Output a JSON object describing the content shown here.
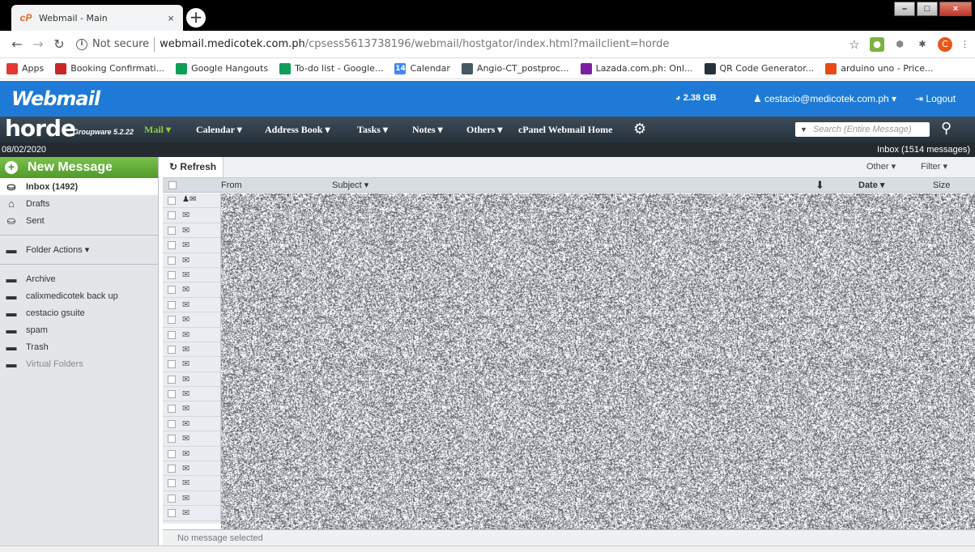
{
  "browser": {
    "tab_title": "Webmail - Main",
    "tab_close": "×",
    "new_tab": "+",
    "security_label": "Not secure",
    "url_host": "webmail.medicotek.com.ph",
    "url_path": "/cpsess5613738196/webmail/hostgator/index.html?mailclient=horde",
    "window_controls": [
      "–",
      "□",
      "×"
    ]
  },
  "bookmarks": [
    {
      "label": "Apps",
      "color": "#e53935",
      "icon": "apps-grid-icon"
    },
    {
      "label": "Booking Confirmati...",
      "color": "#c62828",
      "icon": "airasia-icon"
    },
    {
      "label": "Google Hangouts",
      "color": "#0f9d58",
      "icon": "hangouts-icon"
    },
    {
      "label": "To-do list - Google...",
      "color": "#0f9d58",
      "icon": "todo-icon"
    },
    {
      "label": "Calendar",
      "color": "#4285f4",
      "icon": "calendar-icon",
      "glyph": "14"
    },
    {
      "label": "Angio-CT_postproc...",
      "color": "#455a64",
      "icon": "image-icon"
    },
    {
      "label": "Lazada.com.ph: Onl...",
      "color": "#7b1fa2",
      "icon": "lazada-icon"
    },
    {
      "label": "QR Code Generator...",
      "color": "#263238",
      "icon": "qr-icon"
    },
    {
      "label": "arduino uno - Price...",
      "color": "#e64a19",
      "icon": "shop-icon"
    }
  ],
  "webmail": {
    "logo": "Webmail",
    "quota": "2.38 GB",
    "user": "cestacio@medicotek.com.ph",
    "logout": "Logout"
  },
  "horde": {
    "logo": "horde",
    "version": "Groupware 5.2.22",
    "nav": [
      {
        "label": "Mail ▾",
        "active": true
      },
      {
        "label": "Calendar ▾",
        "active": false
      },
      {
        "label": "Address Book ▾",
        "active": false
      },
      {
        "label": "Tasks ▾",
        "active": false
      },
      {
        "label": "Notes ▾",
        "active": false
      },
      {
        "label": "Others ▾",
        "active": false
      },
      {
        "label": "cPanel Webmail Home",
        "active": false
      }
    ],
    "search_placeholder": "Search (Entire Message)"
  },
  "datebar": {
    "date": "08/02/2020",
    "inbox_summary": "Inbox (1514 messages)"
  },
  "sidebar": {
    "new_message": "New Message",
    "folders_top": [
      {
        "label": "Inbox (1492)",
        "icon": "inbox-icon",
        "active": true
      },
      {
        "label": "Drafts",
        "icon": "drafts-icon",
        "active": false
      },
      {
        "label": "Sent",
        "icon": "sent-icon",
        "active": false
      }
    ],
    "folder_actions": "Folder Actions ▾",
    "folders": [
      {
        "label": "Archive"
      },
      {
        "label": "calixmedicotek back up"
      },
      {
        "label": "cestacio gsuite"
      },
      {
        "label": "spam"
      },
      {
        "label": "Trash"
      }
    ],
    "virtual_folders": "Virtual Folders"
  },
  "main": {
    "refresh": "Refresh",
    "other": "Other ▾",
    "filter": "Filter ▾",
    "columns": {
      "from": "From",
      "subject": "Subject ▾",
      "date": "Date ▾",
      "size": "Size"
    },
    "row_count": 22,
    "preview_text": "No message selected"
  }
}
